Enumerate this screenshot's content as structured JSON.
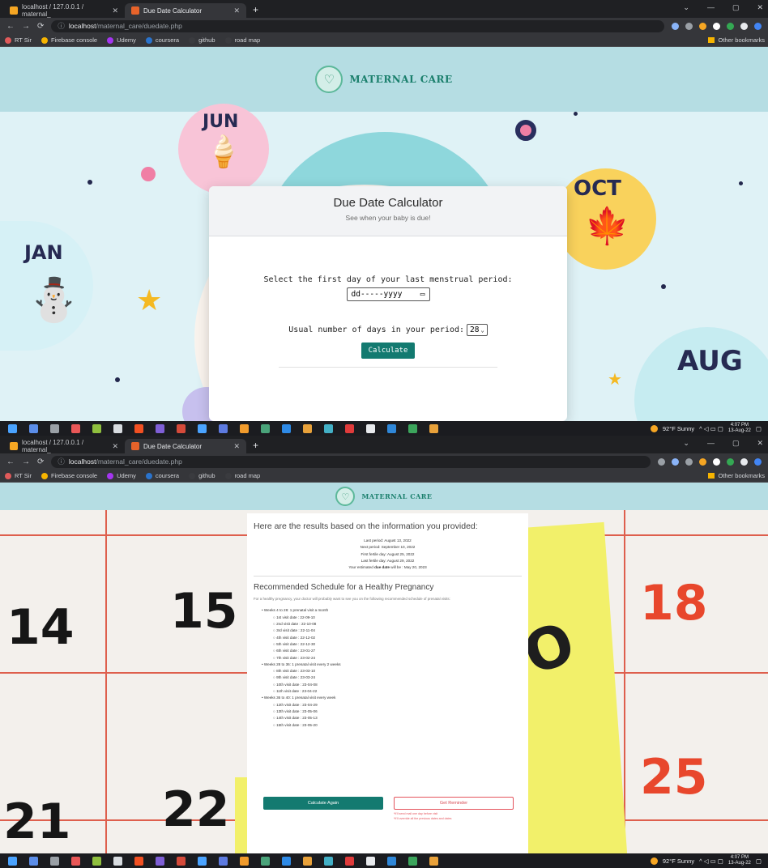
{
  "browser": {
    "tabs": [
      {
        "title": "localhost / 127.0.0.1 / maternal_"
      },
      {
        "title": "Due Date Calculator"
      }
    ],
    "url_host": "localhost",
    "url_path": "/maternal_care/duedate.php",
    "bookmarks": [
      "RT Sir",
      "Firebase console",
      "Udemy",
      "coursera",
      "github",
      "road map"
    ],
    "other_bookmarks": "Other bookmarks"
  },
  "site": {
    "brand": "MATERNAL CARE"
  },
  "scene1": {
    "months": [
      "JUN",
      "OCT",
      "JAN",
      "AUG"
    ]
  },
  "calculator": {
    "title": "Due Date Calculator",
    "subtitle": "See when your baby is due!",
    "period_label": "Select the first day of your last menstrual period:",
    "date_placeholder": "dd-----yyyy",
    "days_label": "Usual number of days in your period:",
    "days_value": "28",
    "calculate_label": "Calculate"
  },
  "results": {
    "title": "Here are the results based on the information you provided:",
    "last_period": "Last period: August 13, 2022",
    "next_period": "Next period: September 10, 2022",
    "first_fertile": "First fertile day: August 25, 2022",
    "last_fertile": "Last fertile day: August 29, 2022",
    "due_prefix": "Your estimated",
    "due_bold": "due date",
    "due_suffix": "will be : May 20, 2023",
    "schedule_title": "Recommended Schedule for a Healthy Pregnancy",
    "schedule_intro": "For a healthy pregnancy, your doctor will probably want to see you on the following recommended schedule of prenatal visits:",
    "groups": [
      {
        "label": "Weeks 4 to 28: 1 prenatal visit a month",
        "visits": [
          "1st visit date : 22-09-10",
          "2nd visit date : 22-10-08",
          "3rd visit date : 22-11-04",
          "4th visit date : 22-12-02",
          "5th visit date : 22-12-30",
          "6th visit date : 23-01-27",
          "7th visit date : 23-02-24"
        ]
      },
      {
        "label": "Weeks 28 to 36: 1 prenatal visit every 2 weeks",
        "visits": [
          "8th visit date : 23-03-10",
          "9th visit date : 23-03-24",
          "10th visit date : 23-04-08",
          "11th visit date : 23-04-22"
        ]
      },
      {
        "label": "Weeks 36 to 40: 1 prenatal visit every week",
        "visits": [
          "12th visit date : 23-04-29",
          "13th visit date : 23-05-06",
          "14th visit date : 23-05-13",
          "15th visit date : 23-05-20"
        ]
      }
    ],
    "calculate_again_label": "Calculate Again",
    "reminder_label": "Get Reminder",
    "reminder_note_1": "*It'll send mail one day before visit",
    "reminder_note_2": "*It'll override all the previous dates and dates"
  },
  "scene2": {
    "calendar_numbers": [
      "14",
      "15",
      "18",
      "21",
      "22",
      "25"
    ]
  },
  "taskbar": {
    "weather": "92°F  Sunny",
    "time": "4:07 PM",
    "date": "13-Aug-22"
  },
  "colors": {
    "teal": "#137a70",
    "header": "#b5dde3",
    "reminder_red": "#e4545d"
  }
}
